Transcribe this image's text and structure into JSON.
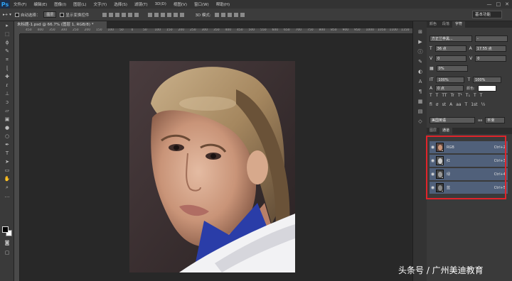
{
  "menubar": {
    "logo": "Ps",
    "items": [
      "文件(F)",
      "编辑(E)",
      "图像(I)",
      "图层(L)",
      "文字(Y)",
      "选择(S)",
      "滤镜(T)",
      "3D(D)",
      "视图(V)",
      "窗口(W)",
      "帮助(H)"
    ],
    "window_controls": [
      "—",
      "□",
      "✕"
    ]
  },
  "options": {
    "auto_select_label": "自动选择：",
    "auto_select_value": "图层",
    "show_transform_label": "显示变换控件",
    "mode_3d_label": "3D 模式:",
    "workspace": "基本功能"
  },
  "document": {
    "tab_title": "未标题-1.psd @ 66.7% (图层 1, RGB/8) *",
    "ruler_ticks": [
      "450",
      "400",
      "350",
      "300",
      "250",
      "200",
      "150",
      "100",
      "50",
      "0",
      "50",
      "100",
      "150",
      "200",
      "250",
      "300",
      "350",
      "400",
      "450",
      "500",
      "550",
      "600",
      "650",
      "700",
      "750",
      "800",
      "850",
      "900",
      "950",
      "1000",
      "1050",
      "1100",
      "1150"
    ]
  },
  "character_panel": {
    "tabs": [
      "颜色",
      "段落",
      "字符"
    ],
    "font_family": "方正兰亭黑...",
    "font_style": "-",
    "font_size": "36 点",
    "leading": "17.55 点",
    "kerning": "0",
    "tracking": "0",
    "tsume": "0%",
    "vscale": "100%",
    "hscale": "100%",
    "baseline": "0 点",
    "color_label": "颜色:",
    "style_buttons": [
      "T",
      "T",
      "TT",
      "Tr",
      "T¹",
      "T₁",
      "T",
      "T"
    ],
    "opentype": [
      "fi",
      "σ",
      "st",
      "A",
      "aa",
      "T",
      "1st",
      "½"
    ],
    "language": "美国英语",
    "aa_label": "aa",
    "aa_value": "平滑"
  },
  "channels_panel": {
    "tabs": [
      "图层",
      "通道"
    ],
    "channels": [
      {
        "name": "RGB",
        "shortcut": "Ctrl+2"
      },
      {
        "name": "红",
        "shortcut": "Ctrl+3"
      },
      {
        "name": "绿",
        "shortcut": "Ctrl+4"
      },
      {
        "name": "蓝",
        "shortcut": "Ctrl+5"
      }
    ]
  },
  "watermark": "头条号 / 广州美迪教育",
  "colors": {
    "highlight": "#e0242b",
    "channel_row": "#50607a",
    "accent": "#2fa3f6"
  }
}
